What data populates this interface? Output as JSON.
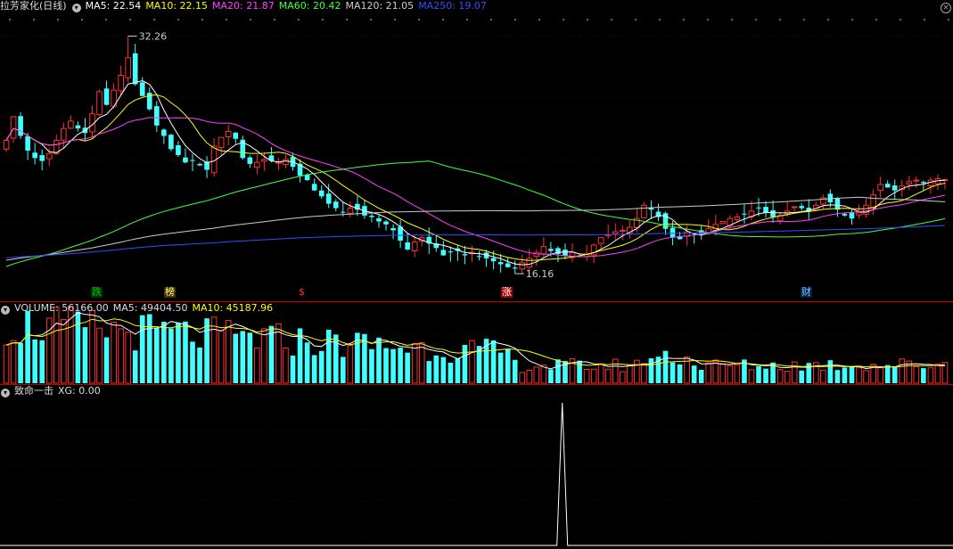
{
  "price_panel": {
    "title": "拉芳家化(日线)",
    "indicators": [
      {
        "label": "MA5: 22.54",
        "color": "#ffffff"
      },
      {
        "label": "MA10: 22.15",
        "color": "#ffff00"
      },
      {
        "label": "MA20: 21.87",
        "color": "#ff40ff"
      },
      {
        "label": "MA60: 20.42",
        "color": "#40ff40"
      },
      {
        "label": "MA120: 21.05",
        "color": "#cccccc"
      },
      {
        "label": "MA250: 19.07",
        "color": "#3050ff"
      }
    ],
    "high_label": "32.26",
    "low_label": "16.16",
    "markers": [
      {
        "text": "跌",
        "color": "#00c000",
        "bg": "#003000"
      },
      {
        "text": "榜",
        "color": "#ffff80",
        "bg": "#403000"
      },
      {
        "text": "$",
        "color": "#ff3030",
        "bg": "#000000"
      },
      {
        "text": "涨",
        "color": "#ffffff",
        "bg": "#a00000"
      },
      {
        "text": "财",
        "color": "#80c0ff",
        "bg": "#002040"
      }
    ],
    "colors": {
      "up": "#ff3030",
      "down": "#40ffff"
    }
  },
  "volume_panel": {
    "label": "VOLUME: 56166.00",
    "ma5": "MA5: 49404.50",
    "ma10": "MA10: 45187.96"
  },
  "signal_panel": {
    "label": "致命一击",
    "xg": "XG: 0.00"
  },
  "chart_data": [
    {
      "type": "candlestick",
      "title": "拉芳家化(日线)",
      "ylim": [
        15.5,
        33.5
      ],
      "high": 32.26,
      "low": 16.16,
      "closes": [
        25.2,
        26.8,
        25.5,
        24.5,
        24.0,
        23.8,
        24.3,
        25.2,
        26.0,
        26.5,
        26.0,
        25.7,
        27.0,
        28.5,
        27.6,
        28.6,
        29.6,
        30.8,
        29.0,
        28.2,
        27.3,
        26.2,
        25.5,
        24.6,
        24.2,
        23.7,
        23.8,
        23.5,
        23.2,
        24.8,
        25.4,
        25.8,
        25.3,
        24.0,
        23.6,
        23.7,
        23.9,
        23.8,
        23.7,
        23.9,
        23.4,
        22.8,
        22.5,
        21.8,
        21.4,
        20.9,
        20.6,
        20.3,
        20.6,
        20.5,
        20.1,
        20.0,
        19.7,
        19.5,
        19.1,
        18.4,
        17.8,
        18.3,
        18.6,
        18.2,
        17.9,
        17.4,
        17.6,
        17.7,
        17.4,
        17.6,
        17.3,
        17.2,
        17.0,
        16.8,
        16.6,
        16.5,
        16.9,
        17.2,
        17.6,
        18.0,
        17.7,
        17.5,
        17.4,
        17.6,
        17.3,
        17.5,
        18.1,
        18.6,
        18.8,
        19.0,
        19.1,
        19.3,
        19.9,
        20.8,
        20.5,
        20.0,
        19.2,
        18.6,
        18.5,
        19.0,
        18.9,
        18.9,
        19.2,
        19.5,
        19.7,
        19.9,
        20.0,
        20.2,
        20.4,
        20.6,
        20.3,
        20.0,
        20.1,
        20.4,
        20.7,
        20.6,
        20.4,
        20.8,
        21.3,
        21.0,
        20.5,
        20.1,
        19.9,
        20.3,
        20.8,
        21.5,
        22.2,
        22.0,
        21.8,
        22.1,
        22.4,
        22.5,
        22.3,
        22.5,
        22.6,
        22.54
      ],
      "volume": {
        "last": 56166.0,
        "ma5": 49404.5,
        "ma10": 45187.96
      },
      "signal": {
        "last": 0.0,
        "peak_fraction": 0.59
      }
    }
  ]
}
